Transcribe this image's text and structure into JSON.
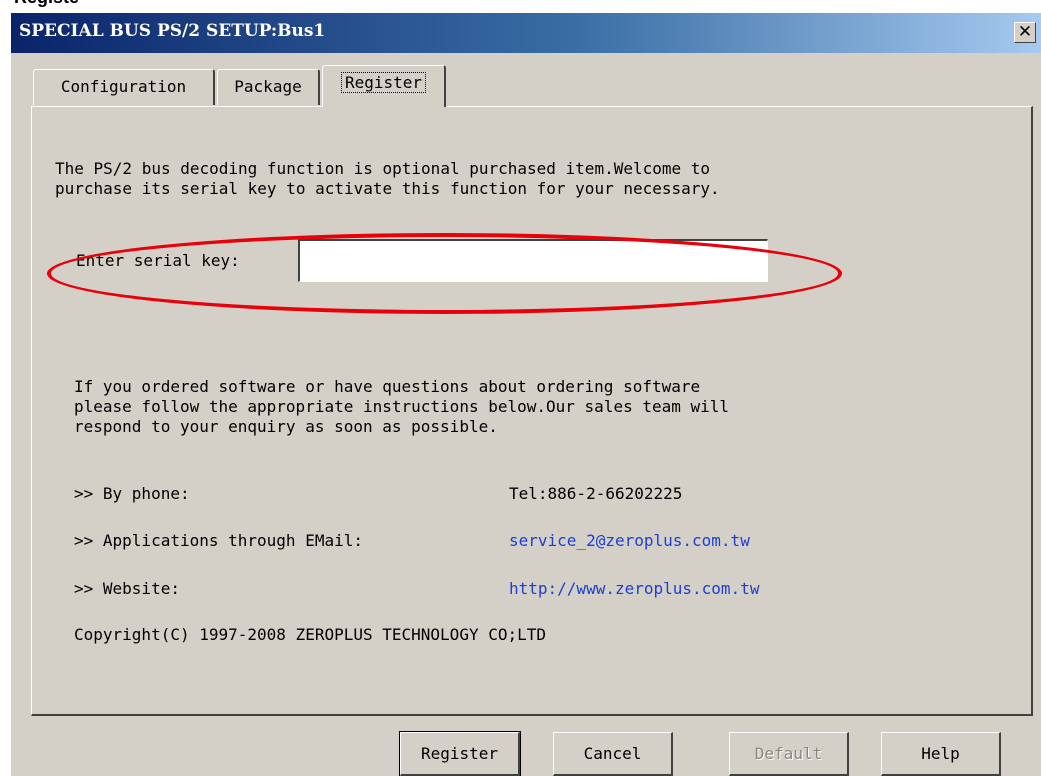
{
  "cut_text": "Registe",
  "window": {
    "title": "SPECIAL BUS PS/2 SETUP:Bus1",
    "close_glyph": "✕"
  },
  "tabs": [
    {
      "label": "Configuration"
    },
    {
      "label": "Package"
    },
    {
      "label": "Register",
      "active": true
    }
  ],
  "register": {
    "intro_line1": "The PS/2 bus decoding function is optional purchased item.Welcome to",
    "intro_line2": "purchase its serial key to activate this function for your necessary.",
    "serial_label": "Enter serial key:",
    "serial_value": "",
    "order_line1": "If you ordered software or have questions about ordering software",
    "order_line2": "please follow the appropriate instructions below.Our sales team will",
    "order_line3": "respond to your enquiry as soon as possible.",
    "phone_label": ">> By phone:",
    "phone_value": "Tel:886-2-66202225",
    "email_label": ">> Applications through EMail:",
    "email_value": "service_2@zeroplus.com.tw",
    "website_label": ">> Website:",
    "website_value": "http://www.zeroplus.com.tw",
    "copyright": "Copyright(C) 1997-2008 ZEROPLUS TECHNOLOGY CO;LTD"
  },
  "buttons": {
    "register": "Register",
    "cancel": "Cancel",
    "default": "Default",
    "help": "Help"
  },
  "colors": {
    "link": "#1b3fd6",
    "highlight": "#e8000a",
    "face": "#d4d0c8"
  }
}
